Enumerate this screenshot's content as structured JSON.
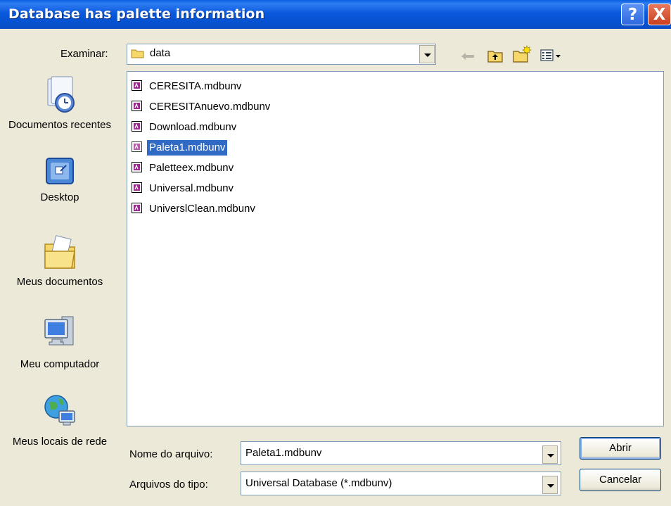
{
  "window": {
    "title": "Database has palette information",
    "help_label": "?",
    "close_label": "X"
  },
  "lookin": {
    "label": "Examinar:",
    "value": "data"
  },
  "toolbar": {
    "icons": [
      "back-arrow-icon",
      "up-folder-icon",
      "new-folder-icon",
      "view-menu-icon"
    ]
  },
  "places": [
    {
      "label": "Documentos recentes",
      "icon": "recent-documents-icon"
    },
    {
      "label": "Desktop",
      "icon": "desktop-icon"
    },
    {
      "label": "Meus documentos",
      "icon": "my-documents-icon"
    },
    {
      "label": "Meu computador",
      "icon": "my-computer-icon"
    },
    {
      "label": "Meus locais de rede",
      "icon": "network-places-icon"
    }
  ],
  "files": [
    {
      "name": "CERESITA.mdbunv",
      "selected": false
    },
    {
      "name": "CERESITAnuevo.mdbunv",
      "selected": false
    },
    {
      "name": "Download.mdbunv",
      "selected": false
    },
    {
      "name": "Paleta1.mdbunv",
      "selected": true
    },
    {
      "name": "Paletteex.mdbunv",
      "selected": false
    },
    {
      "name": "Universal.mdbunv",
      "selected": false
    },
    {
      "name": "UniverslClean.mdbunv",
      "selected": false
    }
  ],
  "filename": {
    "label": "Nome do arquivo:",
    "value": "Paleta1.mdbunv"
  },
  "filetype": {
    "label": "Arquivos do tipo:",
    "value": "Universal Database (*.mdbunv)"
  },
  "buttons": {
    "open": "Abrir",
    "cancel": "Cancelar"
  },
  "colors": {
    "titlebar": "#0a5fe0",
    "selection": "#316ac5",
    "dialog_bg": "#ece9d8"
  }
}
